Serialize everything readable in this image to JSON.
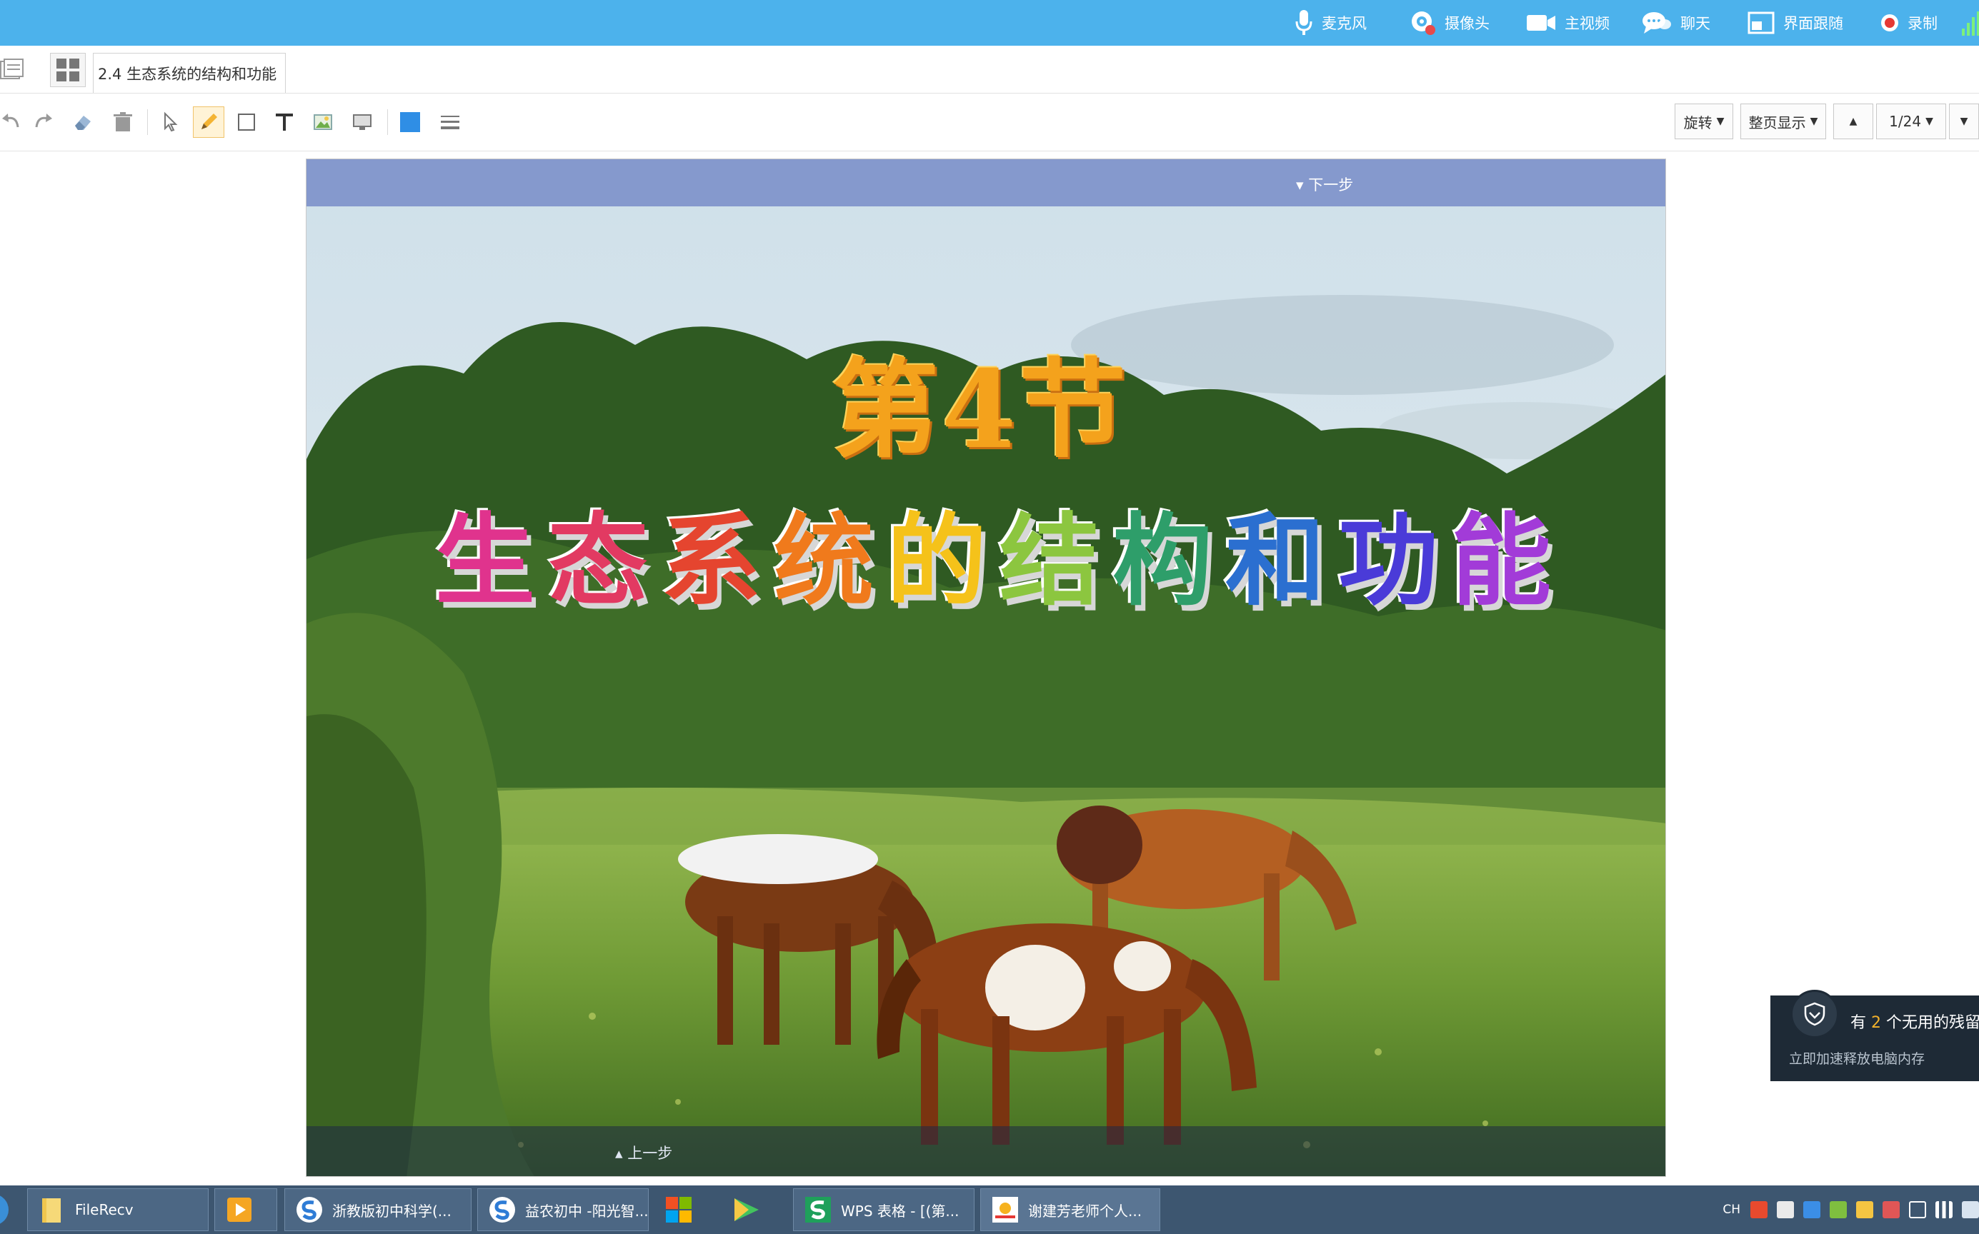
{
  "topbar": {
    "items": [
      {
        "label": "麦克风",
        "icon": "microphone-icon"
      },
      {
        "label": "摄像头",
        "icon": "camera-icon"
      },
      {
        "label": "主视频",
        "icon": "video-icon"
      },
      {
        "label": "聊天",
        "icon": "chat-icon"
      },
      {
        "label": "界面跟随",
        "icon": "layout-follow-icon"
      },
      {
        "label": "录制",
        "icon": "record-icon"
      }
    ],
    "accent_color": "#4cb2ec"
  },
  "tabs": {
    "active": "2.4 生态系统的结构和功能"
  },
  "toolbar": {
    "tools": [
      "undo-icon",
      "redo-icon",
      "eraser-icon",
      "delete-icon",
      "select-icon",
      "pen-icon",
      "rectangle-icon",
      "text-icon",
      "image-icon",
      "screen-icon",
      "color-icon",
      "line-style-icon"
    ],
    "rotate_label": "旋转",
    "fit_label": "整页显示",
    "page_indicator": "1/24"
  },
  "slide": {
    "next_label": "下一步",
    "prev_label": "上一步",
    "section_title": "第4节",
    "main_title_chars": [
      "生",
      "态",
      "系",
      "统",
      "的",
      "结",
      "构",
      "和",
      "功",
      "能"
    ],
    "main_title_colors": [
      "#e0338d",
      "#e23a62",
      "#e5452f",
      "#f07a1c",
      "#f5c21a",
      "#8cc63f",
      "#2e9e6a",
      "#2b6fd0",
      "#4a3bd8",
      "#a23bd8"
    ]
  },
  "notification": {
    "line1_prefix": "有 ",
    "line1_count": "2",
    "line1_suffix": " 个无用的残留进",
    "line2": "立即加速释放电脑内存"
  },
  "taskbar": {
    "items": [
      {
        "label": "FileRecv",
        "icon": "folder-icon"
      },
      {
        "label": "",
        "icon": "media-player-icon"
      },
      {
        "label": "浙教版初中科学(...",
        "icon": "sogou-browser-icon"
      },
      {
        "label": "益农初中 -阳光智...",
        "icon": "sogou-browser-icon"
      },
      {
        "label": "",
        "icon": "windows-store-icon"
      },
      {
        "label": "",
        "icon": "video-player-icon"
      },
      {
        "label": "WPS 表格 - [(第...",
        "icon": "wps-sheet-icon"
      },
      {
        "label": "谢建芳老师个人...",
        "icon": "live-app-icon"
      }
    ],
    "tray_lang": "CH"
  }
}
